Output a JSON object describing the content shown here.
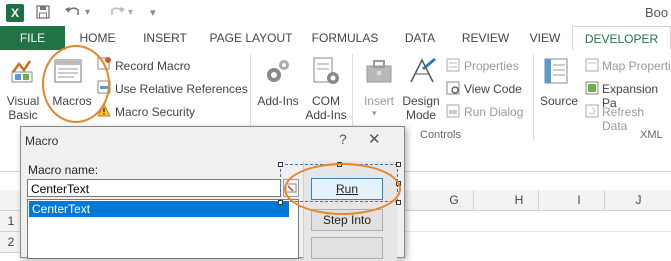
{
  "window": {
    "title": "Boo",
    "app_icon": "X"
  },
  "qat": {
    "save_icon": "save-icon",
    "undo_icon": "undo-icon",
    "redo_icon": "redo-icon"
  },
  "tabs": [
    {
      "label": "FILE"
    },
    {
      "label": "HOME"
    },
    {
      "label": "INSERT"
    },
    {
      "label": "PAGE LAYOUT"
    },
    {
      "label": "FORMULAS"
    },
    {
      "label": "DATA"
    },
    {
      "label": "REVIEW"
    },
    {
      "label": "VIEW"
    },
    {
      "label": "DEVELOPER"
    }
  ],
  "ribbon": {
    "code": {
      "visual_basic": [
        "Visual",
        "Basic"
      ],
      "macros": "Macros",
      "record_macro": "Record Macro",
      "relative_refs": "Use Relative References",
      "macro_security": "Macro Security"
    },
    "addins": {
      "addins": "Add-Ins",
      "com_addins": [
        "COM",
        "Add-Ins"
      ]
    },
    "controls": {
      "insert": "Insert",
      "design_mode": [
        "Design",
        "Mode"
      ],
      "properties": "Properties",
      "view_code": "View Code",
      "run_dialog": "Run Dialog",
      "group_label": "Controls"
    },
    "xml": {
      "source": "Source",
      "map_properties": "Map Properti",
      "expansion_packs": "Expansion Pa",
      "refresh_data": "Refresh Data",
      "group_label": "XML"
    }
  },
  "columns": [
    "G",
    "H",
    "I",
    "J"
  ],
  "rows": [
    "1",
    "2"
  ],
  "dialog": {
    "title": "Macro",
    "help": "?",
    "close": "✕",
    "name_label": "Macro name:",
    "name_value": "CenterText",
    "list_items": [
      "CenterText"
    ],
    "buttons": {
      "run": "Run",
      "step_into": "Step Into"
    }
  },
  "colors": {
    "excel_green": "#217346",
    "highlight": "#e8852a",
    "selection": "#0078d7"
  }
}
